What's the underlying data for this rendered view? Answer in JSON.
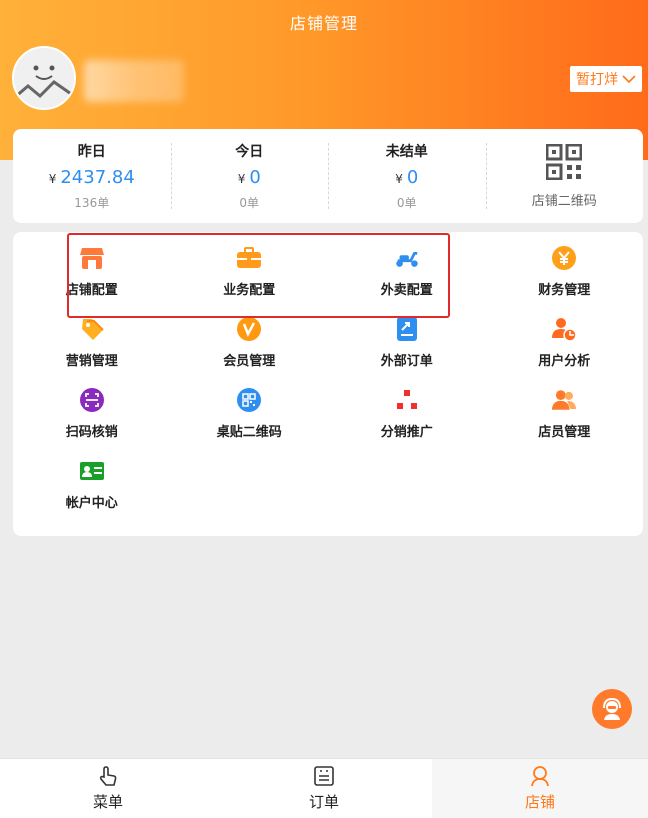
{
  "header": {
    "title": "店铺管理",
    "status_label": "暂打烊"
  },
  "stats": [
    {
      "label": "昨日",
      "currency": "¥",
      "value": "2437.84",
      "orders": "136单"
    },
    {
      "label": "今日",
      "currency": "¥",
      "value": "0",
      "orders": "0单"
    },
    {
      "label": "未结单",
      "currency": "¥",
      "value": "0",
      "orders": "0单"
    }
  ],
  "qr": {
    "label": "店铺二维码"
  },
  "menu": [
    {
      "label": "店铺配置",
      "icon": "store-icon"
    },
    {
      "label": "业务配置",
      "icon": "briefcase-icon"
    },
    {
      "label": "外卖配置",
      "icon": "scooter-icon"
    },
    {
      "label": "财务管理",
      "icon": "yen-coin-icon"
    },
    {
      "label": "营销管理",
      "icon": "tag-icon"
    },
    {
      "label": "会员管理",
      "icon": "vip-icon"
    },
    {
      "label": "外部订单",
      "icon": "external-order-icon"
    },
    {
      "label": "用户分析",
      "icon": "user-chart-icon"
    },
    {
      "label": "扫码核销",
      "icon": "scan-icon"
    },
    {
      "label": "桌贴二维码",
      "icon": "table-qr-icon"
    },
    {
      "label": "分销推广",
      "icon": "distribution-icon"
    },
    {
      "label": "店员管理",
      "icon": "staff-icon"
    },
    {
      "label": "帐户中心",
      "icon": "account-card-icon"
    }
  ],
  "tabs": [
    {
      "label": "菜单",
      "icon": "hand-pointer-icon",
      "active": false
    },
    {
      "label": "订单",
      "icon": "order-list-icon",
      "active": false
    },
    {
      "label": "店铺",
      "icon": "user-outline-icon",
      "active": true
    }
  ],
  "colors": {
    "accent": "#ff7a1a",
    "value_blue": "#2f8ff0",
    "highlight_red": "#e12a2a"
  }
}
